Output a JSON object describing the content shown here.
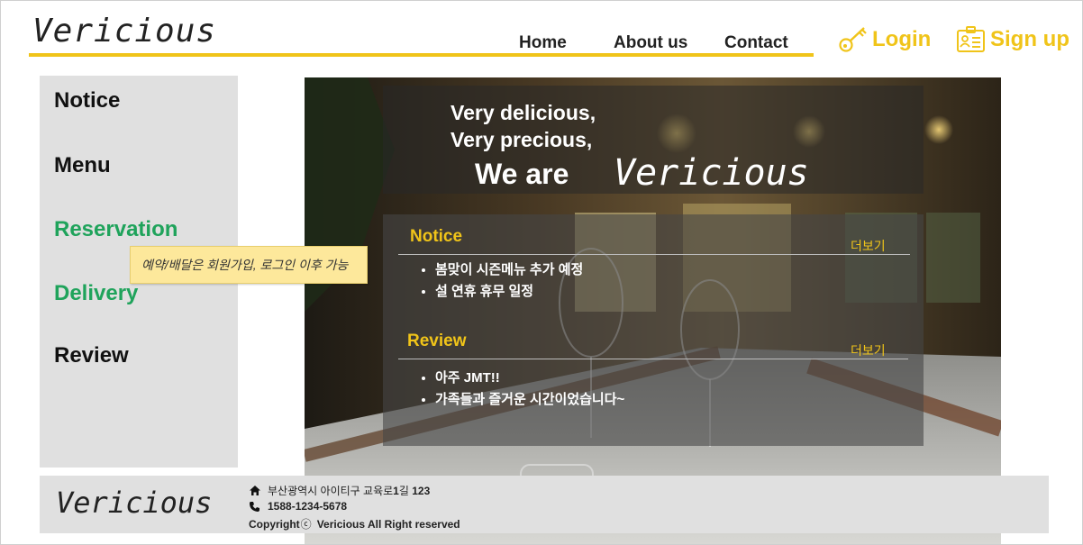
{
  "header": {
    "logo": "Vericious",
    "nav": [
      {
        "label": "Home"
      },
      {
        "label": "About us"
      },
      {
        "label": "Contact"
      }
    ],
    "login_label": "Login",
    "signup_label": "Sign up",
    "accent_color": "#f0c419"
  },
  "sidebar": {
    "items": [
      {
        "label": "Notice"
      },
      {
        "label": "Menu"
      },
      {
        "label": "Reservation"
      },
      {
        "label": "Delivery"
      },
      {
        "label": "Review"
      }
    ],
    "tooltip": "예약/배달은 회원가입, 로그인 이후 가능"
  },
  "hero": {
    "line1": "Very delicious,",
    "line2": "Very precious,",
    "line3_prefix": "We are",
    "line3_brand": "Vericious"
  },
  "notice": {
    "title": "Notice",
    "more": "더보기",
    "items": [
      "봄맞이 시즌메뉴 추가 예정",
      "설 연휴 휴무 일정"
    ]
  },
  "review": {
    "title": "Review",
    "more": "더보기",
    "items": [
      "아주 JMT!!",
      "가족들과 즐거운 시간이었습니다~"
    ]
  },
  "footer": {
    "logo": "Vericious",
    "address_prefix": "부산광역시 아이티구 교육로",
    "address_num1": "1",
    "address_mid": "길 ",
    "address_num2": "123",
    "phone": "1588-1234-5678",
    "copyright_prefix": "Copyright",
    "copyright_symbol": "ⓒ",
    "copyright_text": "Vericious All Right reserved"
  }
}
